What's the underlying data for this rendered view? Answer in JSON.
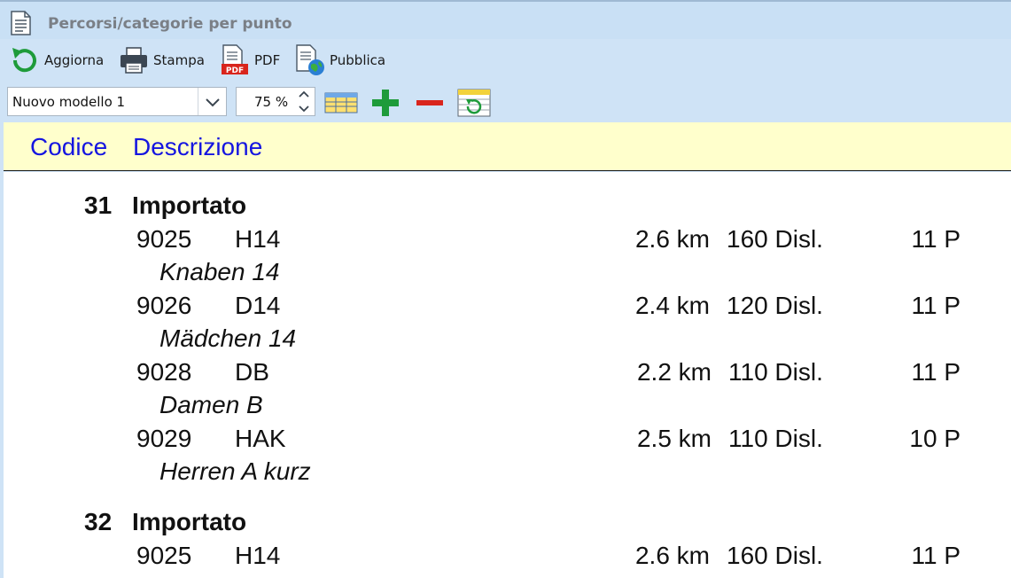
{
  "window": {
    "title": "Percorsi/categorie per punto"
  },
  "toolbar": {
    "refresh_label": "Aggiorna",
    "print_label": "Stampa",
    "pdf_label": "PDF",
    "publish_label": "Pubblica",
    "pdf_badge": "PDF"
  },
  "options": {
    "template_value": "Nuovo modello 1",
    "zoom_value": "75 %"
  },
  "header": {
    "col_code": "Codice",
    "col_desc": "Descrizione"
  },
  "groups": [
    {
      "code": "31",
      "description": "Importato",
      "rows": [
        {
          "code": "9025",
          "category": "H14",
          "length": "2.6 km",
          "climb": "160 Disl.",
          "controls": "11 P",
          "name": "Knaben 14"
        },
        {
          "code": "9026",
          "category": "D14",
          "length": "2.4 km",
          "climb": "120 Disl.",
          "controls": "11 P",
          "name": "Mädchen 14"
        },
        {
          "code": "9028",
          "category": "DB",
          "length": "2.2 km",
          "climb": "110 Disl.",
          "controls": "11 P",
          "name": "Damen B"
        },
        {
          "code": "9029",
          "category": "HAK",
          "length": "2.5 km",
          "climb": "110 Disl.",
          "controls": "10 P",
          "name": "Herren A kurz"
        }
      ]
    },
    {
      "code": "32",
      "description": "Importato",
      "rows": [
        {
          "code": "9025",
          "category": "H14",
          "length": "2.6 km",
          "climb": "160 Disl.",
          "controls": "11 P",
          "name": ""
        }
      ]
    }
  ],
  "colors": {
    "header_bg": "#ffffcc",
    "header_text": "#1515e0",
    "toolbar_bg": "#cfe3f6"
  }
}
